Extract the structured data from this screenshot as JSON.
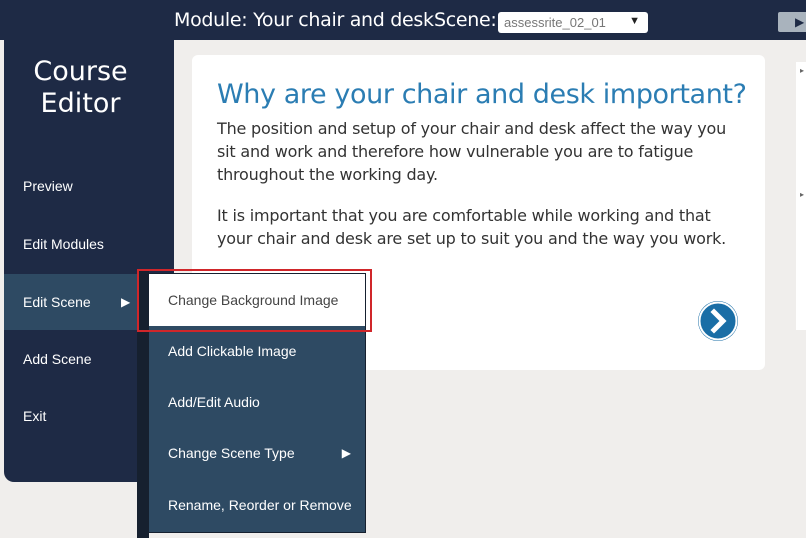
{
  "header": {
    "module_label": "Module: Your chair and desk",
    "scene_label": "Scene:",
    "scene_select": {
      "value": "assessrite_02_01",
      "arrow_icon": "triangle-down-icon"
    },
    "corner_button_icon": "play-icon"
  },
  "sidebar": {
    "brand": "Course Editor",
    "items": [
      {
        "label": "Preview"
      },
      {
        "label": "Edit Modules"
      },
      {
        "label": "Edit Scene",
        "active": true,
        "arrow_icon": "triangle-right-icon"
      },
      {
        "label": "Add Scene"
      },
      {
        "label": "Exit"
      }
    ]
  },
  "card": {
    "title": "Why are your chair and desk important?",
    "paragraphs": [
      "The position and setup of your chair and desk affect the way you sit and work and therefore how vulnerable you are to fatigue throughout the working day.",
      "It is important that you are comfortable while working and that your chair and desk are set up to suit you and the way you work."
    ],
    "next_button_icon": "chevron-right-circle-icon"
  },
  "context_menu": {
    "items": [
      {
        "label": "Change Background Image",
        "highlighted": true
      },
      {
        "label": "Add Clickable Image"
      },
      {
        "label": "Add/Edit Audio"
      },
      {
        "label": "Change Scene Type",
        "arrow_icon": "triangle-right-icon"
      },
      {
        "label": "Rename, Reorder or Remove"
      }
    ]
  },
  "colors": {
    "navy": "#1e2a45",
    "menu_blue": "#2e4a63",
    "title_blue": "#2b7db3",
    "next_button": "#1a6ea6",
    "highlight_border": "#d0262a",
    "page_bg": "#f0eeec"
  }
}
